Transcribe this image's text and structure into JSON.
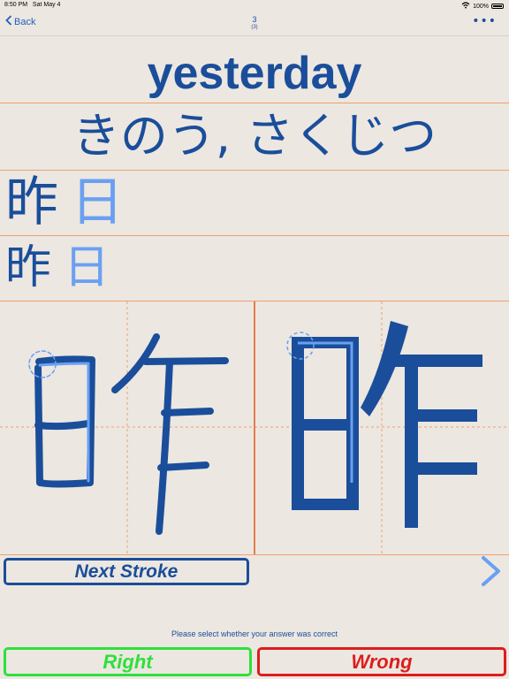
{
  "status": {
    "time": "8:50 PM",
    "date": "Sat May 4",
    "battery": "100%"
  },
  "nav": {
    "back_label": "Back",
    "title": "3",
    "subtitle": "(3)",
    "more_label": "•••"
  },
  "card": {
    "english": "yesterday",
    "reading": "きのう, さくじつ",
    "kanji": "昨",
    "radical": "日",
    "kanji_reference": "昨"
  },
  "controls": {
    "next_stroke_label": "Next Stroke",
    "prompt": "Please select whether your answer was correct",
    "right_label": "Right",
    "wrong_label": "Wrong"
  },
  "colors": {
    "accent": "#1a4e9a",
    "highlight": "#6aa0f2",
    "guide": "#f0a070",
    "right": "#2ee03a",
    "wrong": "#dd1d1d"
  }
}
